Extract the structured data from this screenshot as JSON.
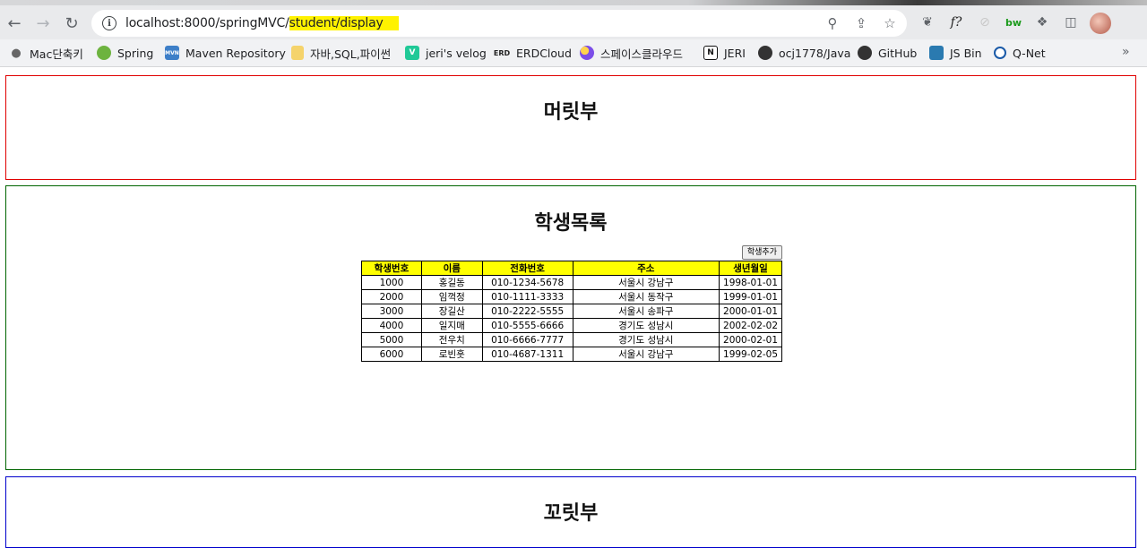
{
  "browser": {
    "url_prefix": "localhost:8000/springMVC/",
    "url_highlight": "student/display",
    "bookmarks": [
      {
        "label": "Mac단축키",
        "icon": "apple-icon",
        "color": "#555555"
      },
      {
        "label": "Spring",
        "icon": "spring-leaf-icon",
        "color": "#6db33f"
      },
      {
        "label": "Maven Repository",
        "icon": "maven-icon",
        "color": "#3d7fc8"
      },
      {
        "label": "자바,SQL,파이썬",
        "icon": "folder-icon",
        "color": "#f5d36b"
      },
      {
        "label": "jeri's velog",
        "icon": "velog-icon",
        "color": "#20c997"
      },
      {
        "label": "ERDCloud",
        "icon": "erd-icon",
        "color": "#222222"
      },
      {
        "label": "스페이스클라우드",
        "icon": "spacecloud-icon",
        "color": "#7b4de8"
      },
      {
        "label": "JERI",
        "icon": "notion-icon",
        "color": "#111111"
      },
      {
        "label": "ocj1778/Java",
        "icon": "github-icon",
        "color": "#333333"
      },
      {
        "label": "GitHub",
        "icon": "github-icon",
        "color": "#333333"
      },
      {
        "label": "JS Bin",
        "icon": "jsbin-icon",
        "color": "#2a7ab0"
      },
      {
        "label": "Q-Net",
        "icon": "qnet-icon",
        "color": "#1a5aa8"
      }
    ],
    "more_label": "»",
    "ext_f_label": "f?",
    "ext_bw_label": "bw",
    "bookmark_initials": {
      "maven": "MVN",
      "velog": "V",
      "erd": "ERD",
      "notion": "N"
    }
  },
  "page": {
    "header_title": "머릿부",
    "main_title": "학생목록",
    "footer_title": "꼬릿부",
    "add_button_label": "학생추가",
    "header_color": "#e00000",
    "main_color": "#006400",
    "footer_color": "#0000cc"
  },
  "students": {
    "columns": [
      "학생번호",
      "이름",
      "전화번호",
      "주소",
      "생년월일"
    ],
    "rows": [
      [
        "1000",
        "홍길동",
        "010-1234-5678",
        "서울시 강남구",
        "1998-01-01"
      ],
      [
        "2000",
        "임꺽정",
        "010-1111-3333",
        "서울시 동작구",
        "1999-01-01"
      ],
      [
        "3000",
        "장길산",
        "010-2222-5555",
        "서울시 송파구",
        "2000-01-01"
      ],
      [
        "4000",
        "일지매",
        "010-5555-6666",
        "경기도 성남시",
        "2002-02-02"
      ],
      [
        "5000",
        "전우치",
        "010-6666-7777",
        "경기도 성남시",
        "2000-02-01"
      ],
      [
        "6000",
        "로빈훗",
        "010-4687-1311",
        "서울시 강남구",
        "1999-02-05"
      ]
    ]
  }
}
